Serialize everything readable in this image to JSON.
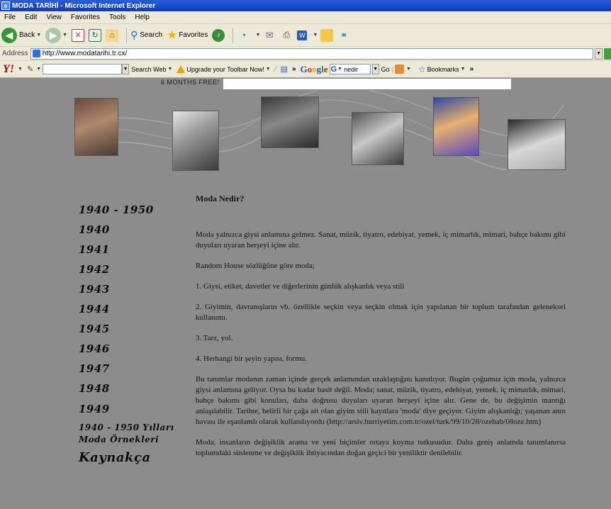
{
  "window": {
    "title": "MODA TARİHİ - Microsoft Internet Explorer"
  },
  "menu": [
    "File",
    "Edit",
    "View",
    "Favorites",
    "Tools",
    "Help"
  ],
  "toolbar": {
    "back_label": "Back",
    "search_label": "Search",
    "favorites_label": "Favorites"
  },
  "address": {
    "label": "Address",
    "url": "http://www.modatarihi.tr.cx/"
  },
  "yahoo_toolbar": {
    "search_web_label": "Search Web",
    "upgrade_label": "Upgrade your Toolbar Now!",
    "google_query": "nedir",
    "go_label": "Go",
    "bookmarks_label": "Bookmarks"
  },
  "ad": {
    "text": "6 MONTHS FREE!"
  },
  "sidebar": {
    "items": [
      "1940 - 1950",
      "1940",
      "1941",
      "1942",
      "1943",
      "1944",
      "1945",
      "1946",
      "1947",
      "1948",
      "1949",
      "1940 - 1950 Yılları",
      "Moda Örnekleri",
      "Kaynakça"
    ]
  },
  "article": {
    "heading": "Moda Nedir?",
    "paragraphs": [
      "Moda yalnızca giysi anlamına gelmez. Sanat, müzik, tiyatro, edebiyat, yemek, iç mimarlık, mimari, bahçe bakımı gibi duyuları uyaran herşeyi içine alır.",
      "Random House sözlüğüne göre moda;",
      "1. Giysi, etiket, davetler ve diğerlerinin günlük alışkanlık veya stili",
      "2. Giyimin, davranışların vb. özellikle seçkin veya seçkin olmak için yapılanan bir toplum tarafından geleneksel kullanımı.",
      "3. Tarz, yol.",
      "4. Herhangi bir şeyin yapısı, formu.",
      "Bu tanımlar modanın zaman içinde gerçek anlamından uzaklaştığını kanıtlıyor. Bugün çoğumuz için moda, yalnızca giysi anlamına geliyor. Oysa bu kadar basit değil. Moda; sanat, müzik, tiyatro, edebiyat, yemek, iç mimarlık, mimari, bahçe bakımı gibi konuları, daha doğrusu duyuları uyaran herşeyi içine alır. Gene de, bu değişimin mantığı anlaşılabilir. Tarihte, belirli bir çağa ait olan giyim stili kayıtlara 'moda' diye geçiyor. Giyim alışkanlığı; yaşanan anın havası ile eşanlamlı olarak kullanılıyordu (http://arsiv.hurriyetim.com.tr/ozel/turk/99/10/28/ozehab/08oze.htm)",
      "Moda, insanların değişiklik arama ve yeni biçimler ortaya koyma tutkusudur. Daha geniş anlamda tanımlanırsa toplumdaki süslenme ve değişiklik ihtiyacından doğan geçici bir yeniliktir denilebilir."
    ]
  },
  "colors": {
    "page_background": "#8c8c8c",
    "title_bar": "#0a3bc0",
    "chrome": "#ece9d8"
  }
}
